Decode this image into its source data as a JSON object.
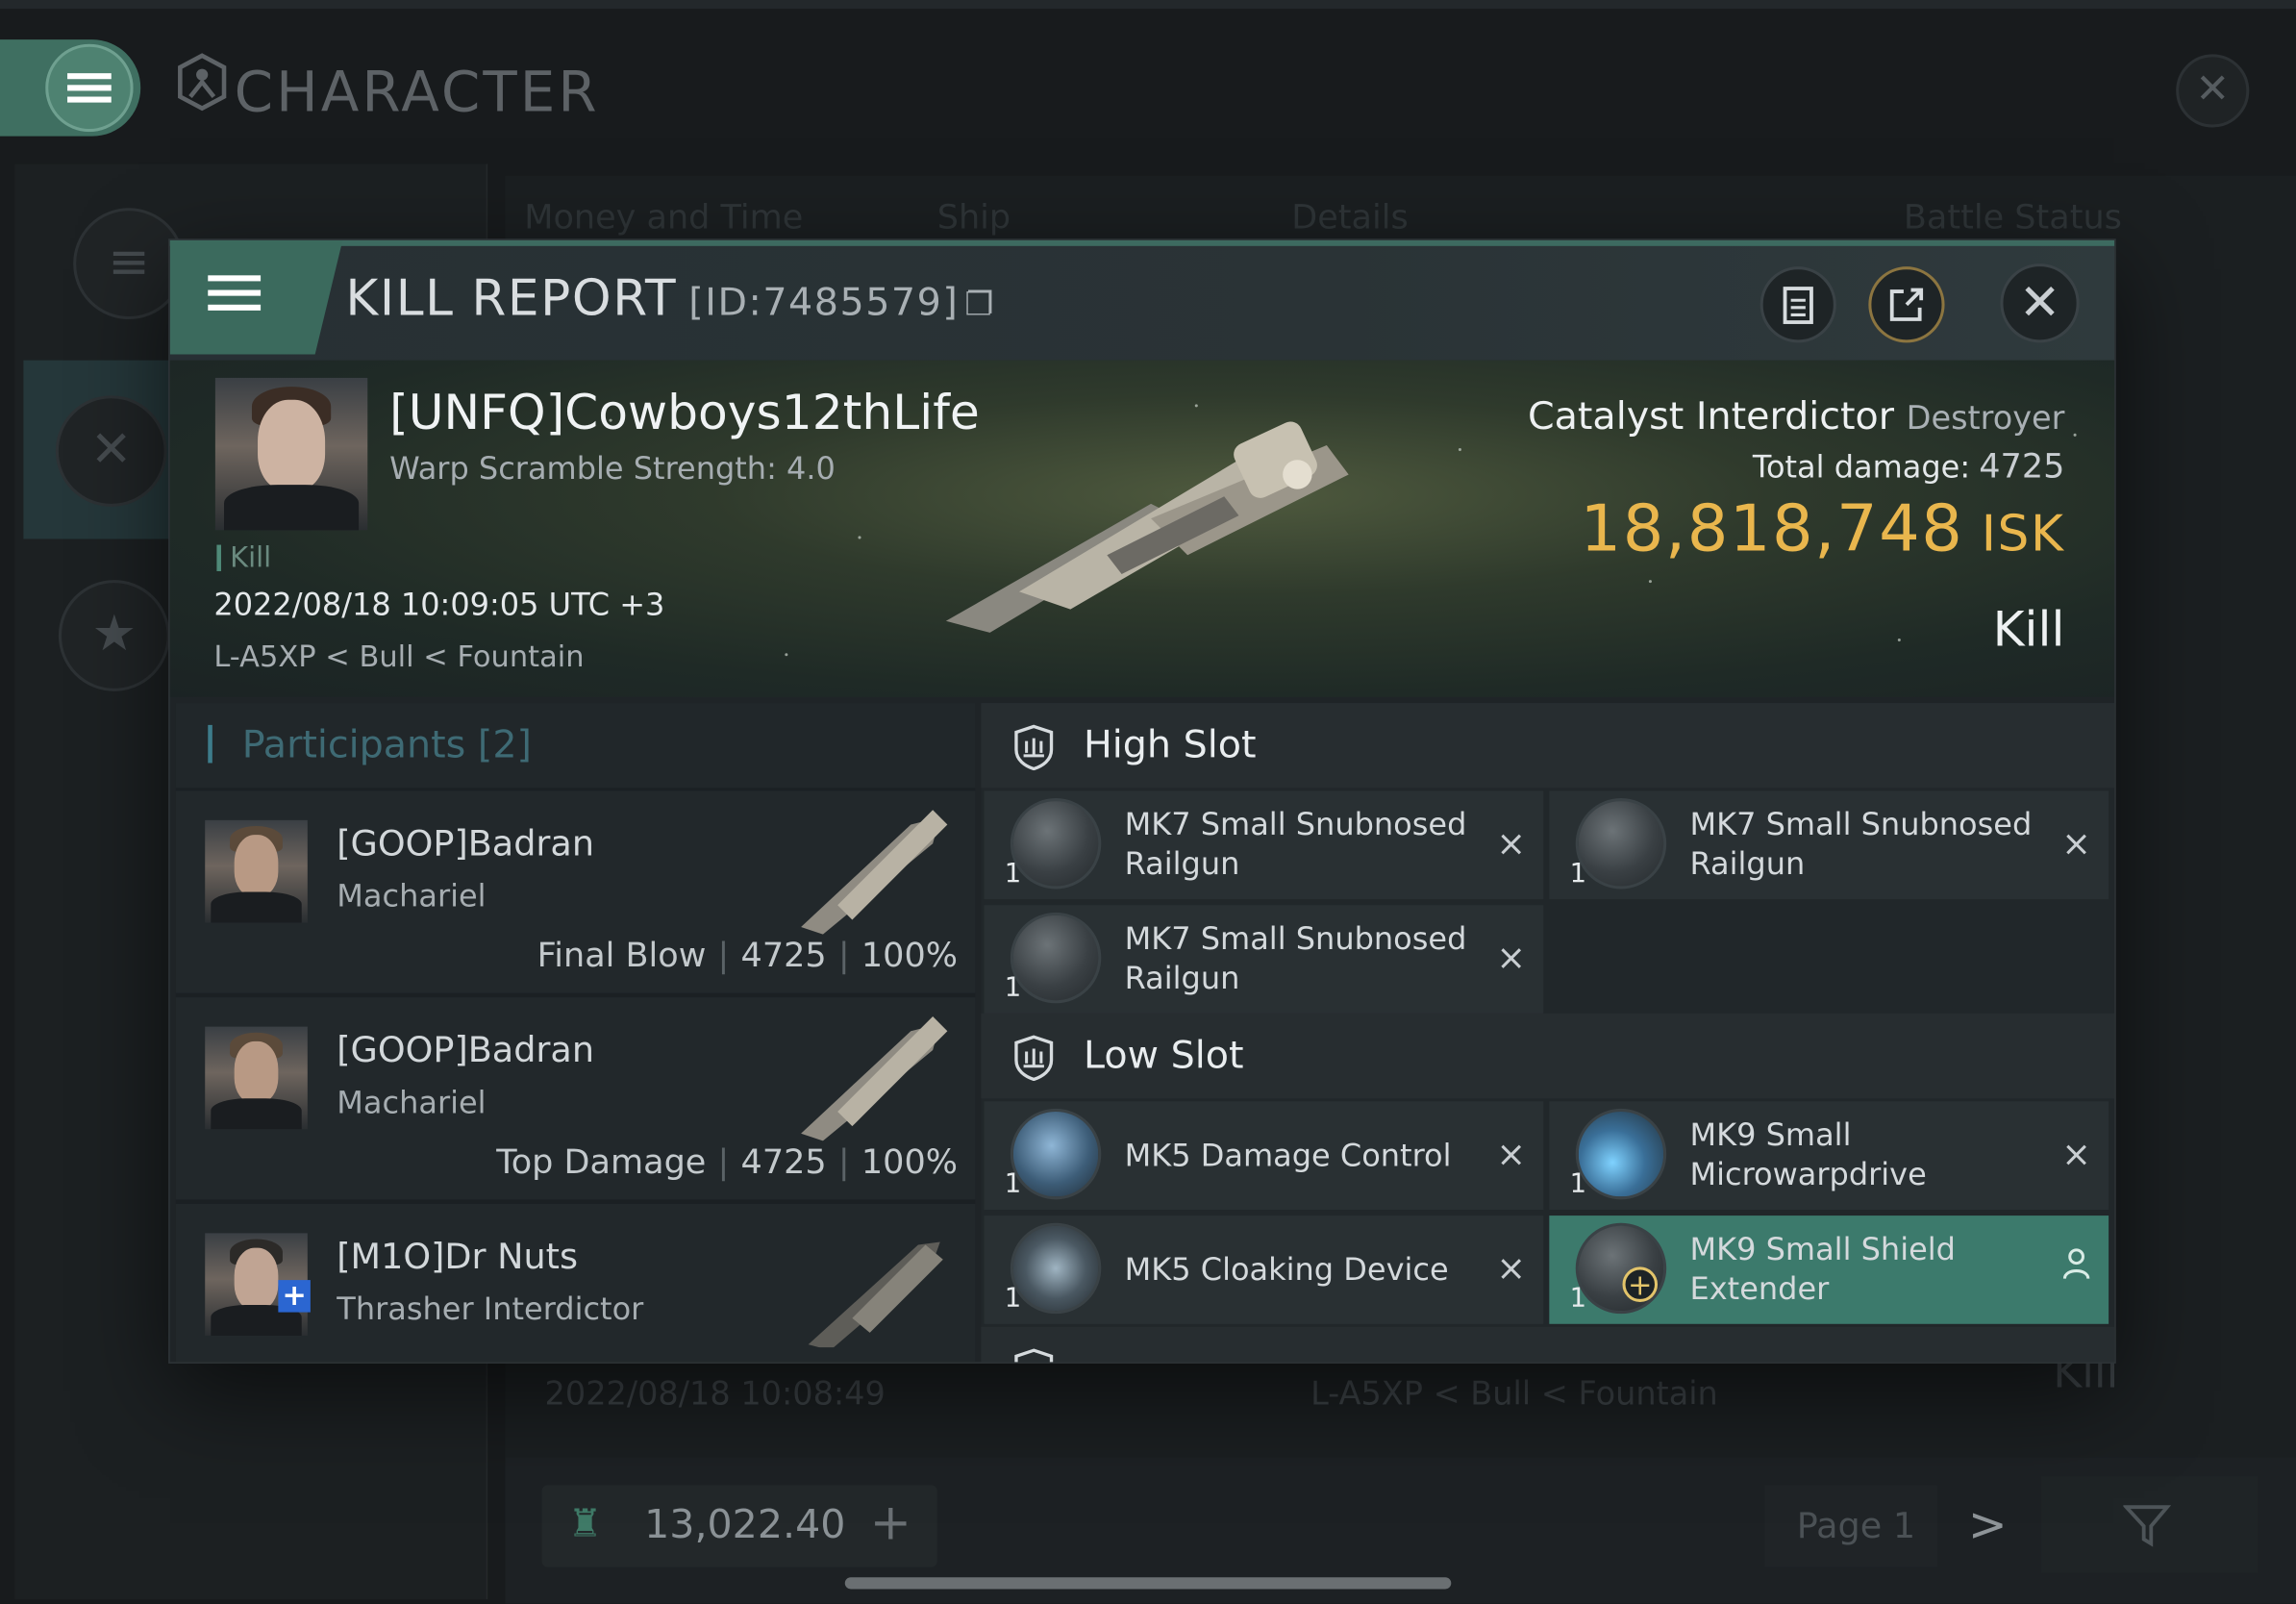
{
  "background_window": {
    "title": "CHARACTER",
    "tabs": [
      "Money and Time",
      "Ship",
      "Details",
      "Battle Status"
    ],
    "row_date": "2022/08/18 10:08:49",
    "row_location": "L-A5XP < Bull < Fountain",
    "row_result": "Kill",
    "isk_balance": "13,022.40",
    "page_label": "Page 1",
    "icons": [
      "menu-icon",
      "character-icon",
      "close-icon",
      "list-icon",
      "crossed-swords-icon",
      "star-badge-icon",
      "isk-icon",
      "plus-icon",
      "chevron-right-icon",
      "filter-icon"
    ]
  },
  "dialog": {
    "title": "KILL REPORT",
    "report_id": "[ID:7485579]",
    "icons": [
      "menu-icon",
      "copy-icon",
      "clipboard-icon",
      "share-icon",
      "close-icon"
    ]
  },
  "victim": {
    "name": "[UNFQ]Cowboys12thLife",
    "warp_scramble": "Warp Scramble Strength: 4.0",
    "tag": "Kill",
    "datetime": "2022/08/18 10:09:05 UTC +3",
    "location": "L-A5XP < Bull < Fountain",
    "ship_name": "Catalyst Interdictor",
    "ship_class": "Destroyer",
    "total_damage_label": "Total damage:",
    "total_damage": "4725",
    "isk_value": "18,818,748",
    "isk_unit": "ISK",
    "result": "Kill",
    "isk_color": "#e9b64d"
  },
  "participants": {
    "title": "Participants",
    "count": "[2]",
    "rows": [
      {
        "name": "[GOOP]Badran",
        "ship": "Machariel",
        "label": "Final Blow",
        "damage": "4725",
        "percent": "100%"
      },
      {
        "name": "[GOOP]Badran",
        "ship": "Machariel",
        "label": "Top Damage",
        "damage": "4725",
        "percent": "100%"
      },
      {
        "name": "[M1O]Dr Nuts",
        "ship": "Thrasher Interdictor"
      }
    ]
  },
  "slots": {
    "high_title": "High Slot",
    "high": [
      {
        "qty": "1",
        "name": "MK7 Small Snubnosed Railgun",
        "action": "×"
      },
      {
        "qty": "1",
        "name": "MK7 Small Snubnosed Railgun",
        "action": "×"
      },
      {
        "qty": "1",
        "name": "MK7 Small Snubnosed Railgun",
        "action": "×"
      }
    ],
    "low_title": "Low Slot",
    "low": [
      {
        "qty": "1",
        "name": "MK5 Damage Control",
        "action": "×"
      },
      {
        "qty": "1",
        "name": "MK9 Small Microwarpdrive",
        "action": "×"
      },
      {
        "qty": "1",
        "name": "MK5 Cloaking Device",
        "action": "×"
      },
      {
        "qty": "1",
        "name": "MK9 Small Shield Extender",
        "action": "person"
      }
    ]
  }
}
